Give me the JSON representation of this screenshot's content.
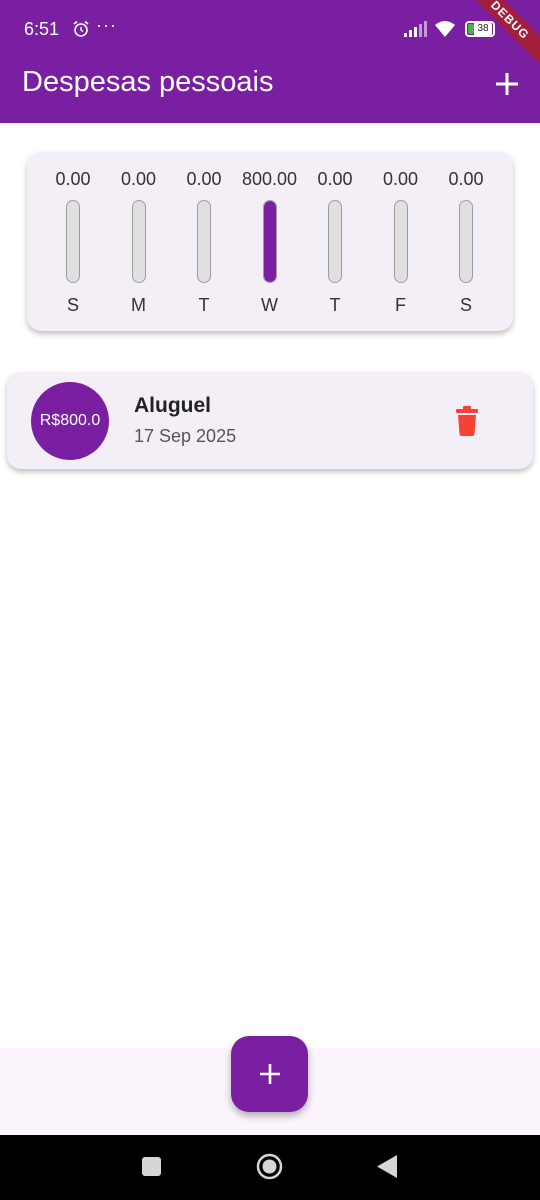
{
  "status_bar": {
    "time": "6:51",
    "more": "···",
    "battery": "38",
    "debug_label": "DEBUG"
  },
  "app_bar": {
    "title": "Despesas pessoais",
    "add_icon": "plus-icon"
  },
  "chart": {
    "accent_color": "#7b1fa2",
    "days": [
      {
        "amount": "0.00",
        "day": "S",
        "fraction": 0
      },
      {
        "amount": "0.00",
        "day": "M",
        "fraction": 0
      },
      {
        "amount": "0.00",
        "day": "T",
        "fraction": 0
      },
      {
        "amount": "800.00",
        "day": "W",
        "fraction": 1
      },
      {
        "amount": "0.00",
        "day": "T",
        "fraction": 0
      },
      {
        "amount": "0.00",
        "day": "F",
        "fraction": 0
      },
      {
        "amount": "0.00",
        "day": "S",
        "fraction": 0
      }
    ]
  },
  "transactions": [
    {
      "amount": "R$800.0",
      "title": "Aluguel",
      "date": "17 Sep 2025",
      "delete_icon": "trash-icon",
      "delete_color": "#f44336"
    }
  ],
  "fab": {
    "icon": "plus-icon"
  },
  "nav_bar": {
    "recent": "square-icon",
    "home": "circle-icon",
    "back": "triangle-back-icon"
  }
}
